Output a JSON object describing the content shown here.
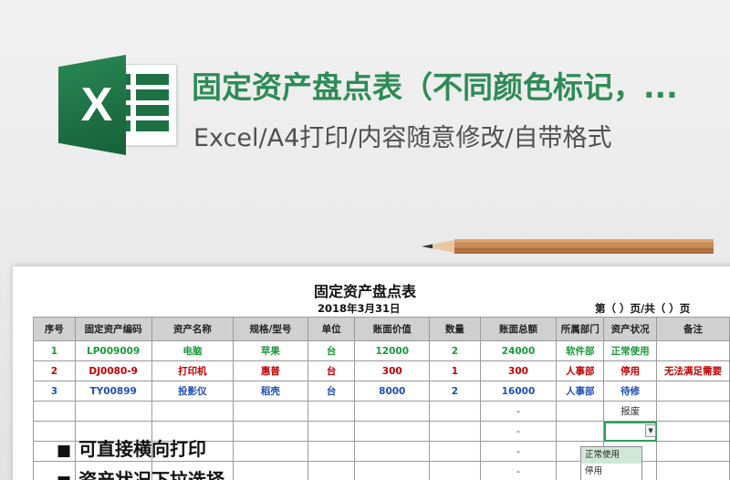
{
  "header": {
    "title": "固定资产盘点表（不同颜色标记，...",
    "subtitle": "Excel/A4打印/内容随意修改/自带格式",
    "logo_letter": "X"
  },
  "sheet": {
    "title": "固定资产盘点表",
    "date": "2018年3月31日",
    "page": "第（ ）页/共（ ）页",
    "columns": [
      "序号",
      "固定资产编码",
      "资产名称",
      "规格/型号",
      "单位",
      "账面价值",
      "数量",
      "账面总额",
      "所属部门",
      "资产状况",
      "备注"
    ],
    "rows": [
      {
        "cells": [
          "1",
          "LP009009",
          "电脑",
          "苹果",
          "台",
          "12000",
          "2",
          "24000",
          "软件部",
          "正常使用",
          ""
        ],
        "color": "#1a9a3a"
      },
      {
        "cells": [
          "2",
          "DJ0080-9",
          "打印机",
          "惠普",
          "台",
          "300",
          "1",
          "300",
          "人事部",
          "停用",
          "无法满足需要"
        ],
        "color": "#c00000"
      },
      {
        "cells": [
          "3",
          "TY00899",
          "投影仪",
          "稻壳",
          "台",
          "8000",
          "2",
          "16000",
          "人事部",
          "待修",
          ""
        ],
        "color": "#1f4fb5"
      },
      {
        "cells": [
          "",
          "",
          "",
          "",
          "",
          "",
          "",
          "-",
          "",
          "报废",
          ""
        ]
      },
      {
        "cells": [
          "",
          "",
          "",
          "",
          "",
          "",
          "",
          "-",
          "",
          "",
          ""
        ]
      },
      {
        "cells": [
          "",
          "",
          "",
          "",
          "",
          "",
          "",
          "-",
          "",
          "",
          ""
        ]
      },
      {
        "cells": [
          "",
          "",
          "",
          "",
          "",
          "",
          "",
          "-",
          "",
          "",
          ""
        ]
      }
    ],
    "dropdown_options": [
      "正常使用",
      "停用"
    ]
  },
  "bullets": [
    "可直接横向打印",
    "资产状况下拉选择"
  ],
  "colors": {
    "excel_green": "#1e7145",
    "title_green": "#2e8b57",
    "row_green": "#1a9a3a",
    "row_red": "#c00000",
    "row_blue": "#1f4fb5"
  },
  "icons": [
    "excel-logo-icon",
    "pencil-icon",
    "dropdown-arrow-icon"
  ]
}
